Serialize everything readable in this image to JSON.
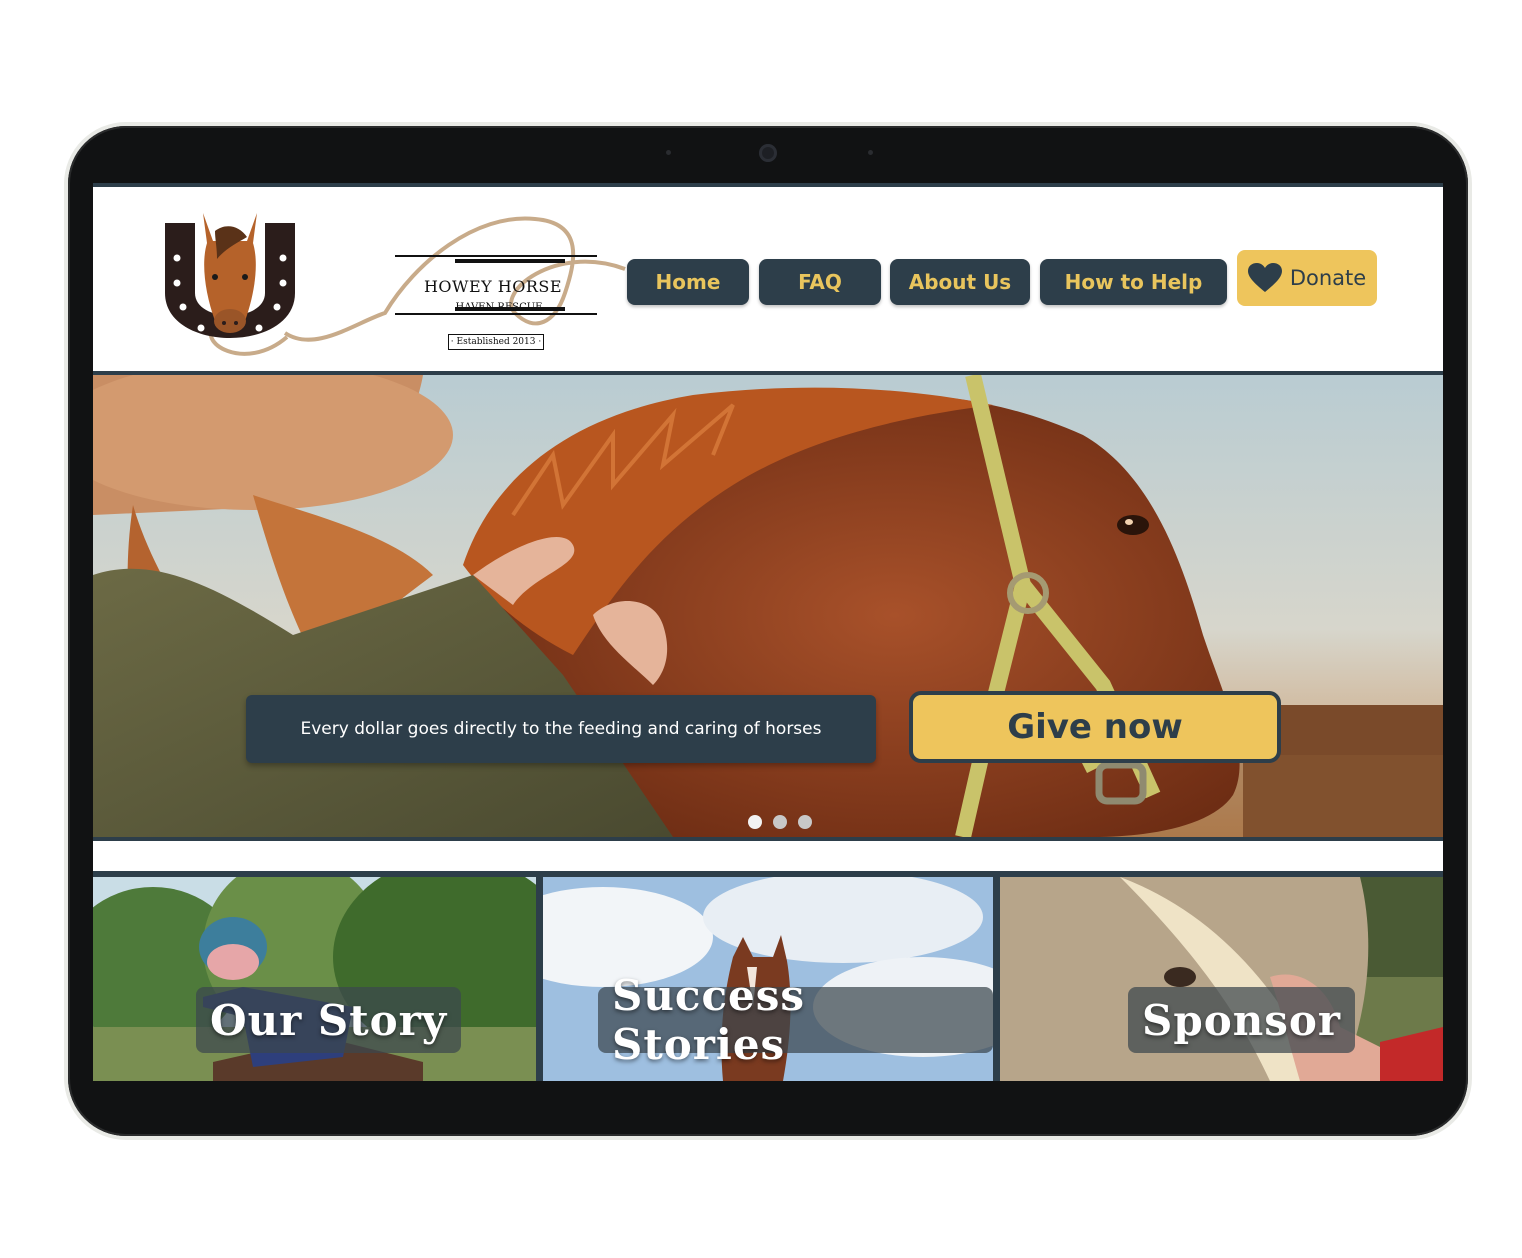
{
  "logo": {
    "title": "HOWEY HORSE",
    "subtitle": "HAVEN RESCUE",
    "established": "· Established 2013 ·"
  },
  "nav": {
    "items": [
      {
        "label": "Home"
      },
      {
        "label": "FAQ"
      },
      {
        "label": "About Us"
      },
      {
        "label": "How to Help"
      }
    ],
    "donate_label": "Donate",
    "donate_icon": "heart-icon"
  },
  "hero": {
    "caption": "Every dollar goes directly to the feeding and caring of horses",
    "cta_label": "Give now",
    "slides_total": 3,
    "active_slide": 1
  },
  "cards": [
    {
      "label": "Our Story"
    },
    {
      "label": "Success Stories"
    },
    {
      "label": "Sponsor"
    }
  ],
  "colors": {
    "navy": "#2d3e4a",
    "gold": "#eec55c",
    "nav_text": "#e9c55d"
  }
}
